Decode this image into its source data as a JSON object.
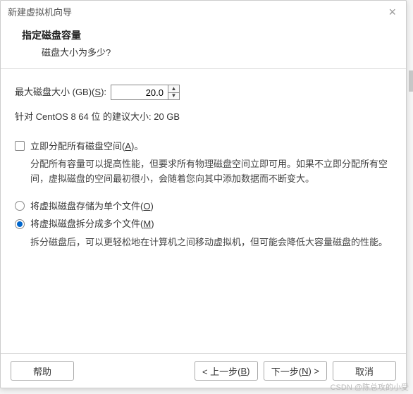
{
  "window": {
    "title": "新建虚拟机向导"
  },
  "header": {
    "title": "指定磁盘容量",
    "subtitle": "磁盘大小为多少?"
  },
  "disk": {
    "label_prefix": "最大磁盘大小 (GB)(",
    "label_key": "S",
    "label_suffix": "):",
    "value": "20.0",
    "recommend": "针对 CentOS 8 64 位 的建议大小: 20 GB"
  },
  "allocate": {
    "label_prefix": "立即分配所有磁盘空间(",
    "label_key": "A",
    "label_suffix": ")。",
    "checked": false,
    "desc": "分配所有容量可以提高性能，但要求所有物理磁盘空间立即可用。如果不立即分配所有空间，虚拟磁盘的空间最初很小，会随着您向其中添加数据而不断变大。"
  },
  "store": {
    "single": {
      "label_prefix": "将虚拟磁盘存储为单个文件(",
      "label_key": "O",
      "label_suffix": ")",
      "selected": false
    },
    "split": {
      "label_prefix": "将虚拟磁盘拆分成多个文件(",
      "label_key": "M",
      "label_suffix": ")",
      "selected": true,
      "desc": "拆分磁盘后，可以更轻松地在计算机之间移动虚拟机，但可能会降低大容量磁盘的性能。"
    }
  },
  "buttons": {
    "help": "帮助",
    "back_prefix": "< 上一步(",
    "back_key": "B",
    "back_suffix": ")",
    "next_prefix": "下一步(",
    "next_key": "N",
    "next_suffix": ") >",
    "cancel": "取消"
  },
  "watermark": "CSDN @陈总攻的小受"
}
